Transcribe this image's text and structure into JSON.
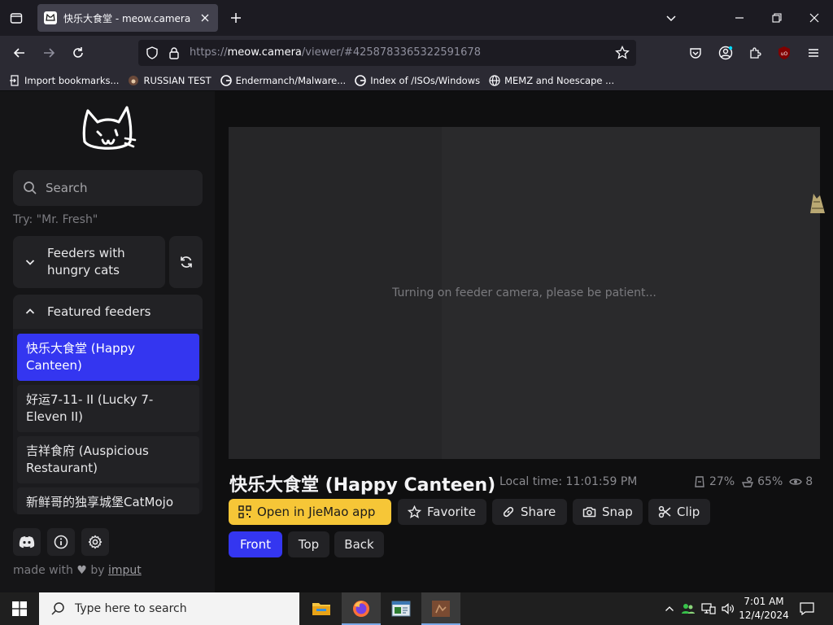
{
  "browser": {
    "tab_title": "快乐大食堂 - meow.camera",
    "url_prefix": "https://",
    "url_domain": "meow.camera",
    "url_path": "/viewer/#4258783365322591678",
    "bookmarks": [
      {
        "label": "Import bookmarks...",
        "icon": "import-icon"
      },
      {
        "label": "RUSSIAN TEST",
        "icon": "paw-icon"
      },
      {
        "label": "Endermanch/Malware...",
        "icon": "github-icon"
      },
      {
        "label": "Index of /ISOs/Windows",
        "icon": "google-icon"
      },
      {
        "label": "MEMZ and Noescape ...",
        "icon": "globe-icon"
      }
    ]
  },
  "sidebar": {
    "search_placeholder": "Search",
    "search_hint": "Try: \"Mr. Fresh\"",
    "group_hungry": "Feeders with hungry cats",
    "group_featured": "Featured feeders",
    "feeders": [
      {
        "label": "快乐大食堂 (Happy Canteen)"
      },
      {
        "label": "好运7-11- II  (Lucky 7-Eleven II)"
      },
      {
        "label": "吉祥食府 (Auspicious Restaurant)"
      },
      {
        "label": "新鲜哥的独享城堡CatMojo"
      }
    ],
    "made_with_prefix": "made with",
    "made_with_by": "by",
    "made_with_link": "imput"
  },
  "viewer": {
    "status_message": "Turning on feeder camera, please be patient...",
    "feeder_title": "快乐大食堂 (Happy Canteen)",
    "local_time": "Local time: 11:01:59 PM",
    "stat_food": "27%",
    "stat_bowl": "65%",
    "stat_viewers": "8",
    "btn_open_app": "Open in JieMao app",
    "btn_favorite": "Favorite",
    "btn_share": "Share",
    "btn_snap": "Snap",
    "btn_clip": "Clip",
    "cam_front": "Front",
    "cam_top": "Top",
    "cam_back": "Back"
  },
  "taskbar": {
    "search_placeholder": "Type here to search",
    "time": "7:01 AM",
    "date": "12/4/2024"
  },
  "colors": {
    "accent_blue": "#3436f0",
    "accent_yellow": "#f6c637"
  }
}
